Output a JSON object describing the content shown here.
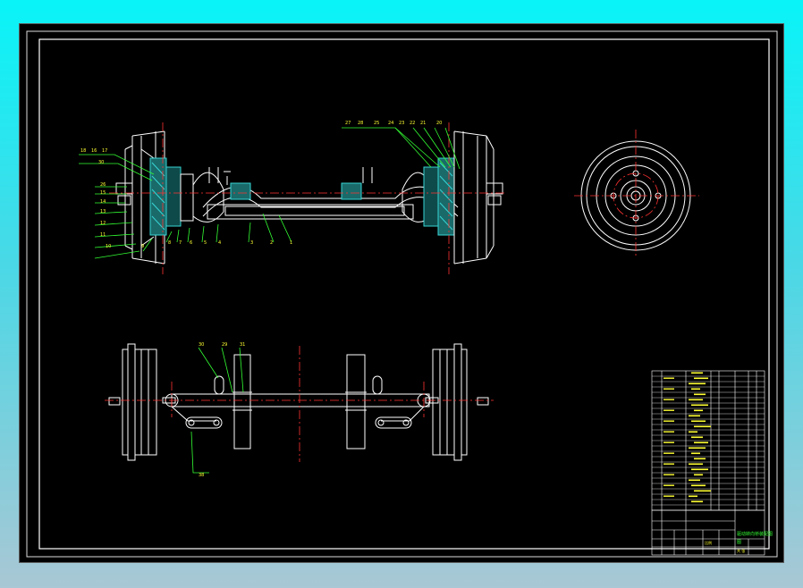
{
  "drawing": {
    "title_block_label": "驱动转向桥装配图",
    "title_block_sub": "图",
    "scale_text": "比例",
    "sheet_text": "共 张"
  },
  "front_view_balloons": {
    "top_left": [
      "18",
      "16",
      "17"
    ],
    "left_side": [
      "30",
      "26",
      "15",
      "14",
      "13",
      "12",
      "11",
      "10"
    ],
    "left_bottom": [
      "9",
      "8",
      "7",
      "6",
      "5",
      "4",
      "3",
      "2",
      "1"
    ],
    "top_right": [
      "27",
      "28",
      "25",
      "24",
      "23",
      "22",
      "21",
      "20"
    ]
  },
  "top_view_balloons": {
    "top": [
      "30",
      "29",
      "31"
    ],
    "bottom": [
      "38"
    ]
  },
  "colors": {
    "line": "#ffffff",
    "center": "#ff3333",
    "leader": "#33ff33",
    "hatch": "#37d4d4",
    "label": "#ffff33"
  }
}
